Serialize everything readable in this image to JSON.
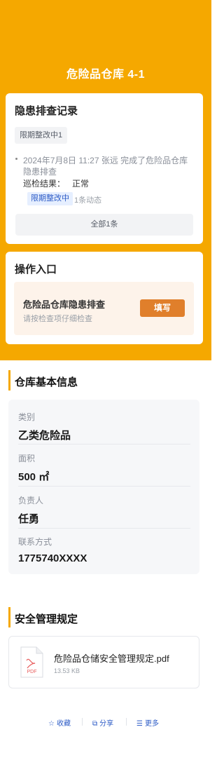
{
  "header": {
    "title": "危险品仓库 4-1"
  },
  "records": {
    "heading": "隐患排查记录",
    "filter_tag": "限期整改中1",
    "items": [
      {
        "text": "2024年7月8日 11:27 张远 完成了危险品仓库隐患排查",
        "result_label": "巡检结果：",
        "result_value": "正常",
        "status": "限期整改中",
        "activity": "1条动态"
      }
    ],
    "all_button": "全部1条"
  },
  "operations": {
    "heading": "操作入口",
    "task_title": "危险品仓库隐患排查",
    "task_subtitle": "请按检查项仔细检查",
    "fill_button": "填写"
  },
  "warehouse_info": {
    "heading": "仓库基本信息",
    "fields": [
      {
        "label": "类别",
        "value": "乙类危险品"
      },
      {
        "label": "面积",
        "value": "500 ㎡"
      },
      {
        "label": "负责人",
        "value": "任勇"
      },
      {
        "label": "联系方式",
        "value": "1775740XXXX"
      }
    ]
  },
  "regulations": {
    "heading": "安全管理规定",
    "file": {
      "icon_text": "PDF",
      "name": "危险品仓储安全管理规定.pdf",
      "size": "13.53 KB"
    }
  },
  "actions": {
    "favorite": {
      "icon": "☆",
      "label": "收藏"
    },
    "share": {
      "icon": "⧉",
      "label": "分享"
    },
    "more": {
      "icon": "☰",
      "label": "更多"
    }
  },
  "colors": {
    "brand": "#f5a800",
    "primary_button": "#e07f2b",
    "link": "#2c5bc6",
    "badge_bg": "#e6efff"
  }
}
